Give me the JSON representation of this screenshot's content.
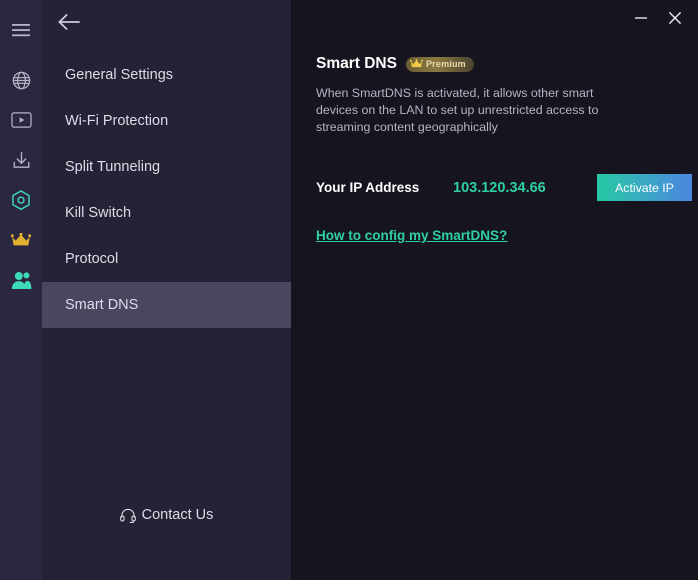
{
  "window": {
    "minimize_label": "–",
    "close_label": "✕"
  },
  "rail": {
    "items": [
      {
        "icon": "hamburger-menu-icon",
        "name": "menu"
      },
      {
        "icon": "globe-icon",
        "name": "locations"
      },
      {
        "icon": "streaming-icon",
        "name": "streaming"
      },
      {
        "icon": "download-icon",
        "name": "downloads"
      },
      {
        "icon": "settings-hexagon-icon",
        "name": "settings"
      },
      {
        "icon": "crown-icon",
        "name": "premium"
      },
      {
        "icon": "users-icon",
        "name": "account"
      }
    ]
  },
  "sidebar": {
    "back_label": "←",
    "items": [
      {
        "label": "General Settings",
        "selected": false
      },
      {
        "label": "Wi-Fi Protection",
        "selected": false
      },
      {
        "label": "Split Tunneling",
        "selected": false
      },
      {
        "label": "Kill Switch",
        "selected": false
      },
      {
        "label": "Protocol",
        "selected": false
      },
      {
        "label": "Smart DNS",
        "selected": true
      }
    ],
    "contact": {
      "label": "Contact Us",
      "icon": "headset-icon"
    }
  },
  "panel": {
    "title": "Smart DNS",
    "badge": "Premium",
    "description": "When SmartDNS is activated, it allows other smart devices on the LAN to set up unrestricted access to streaming content geographically",
    "ip_label": "Your IP Address",
    "ip_value": "103.120.34.66",
    "activate_label": "Activate IP",
    "config_link": "How to config my SmartDNS?"
  },
  "colors": {
    "rail_bg": "#2b2740",
    "menu_bg": "#262236",
    "content_bg": "#16141f",
    "selected_row": "#4b4560",
    "accent_teal": "#2ecfa4",
    "accent_blue": "#4b86e0",
    "crown_gold": "#e0b030",
    "badge_text": "#e8dcae"
  }
}
